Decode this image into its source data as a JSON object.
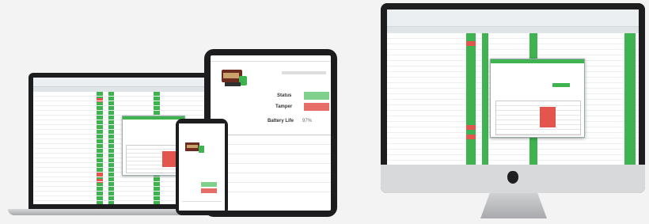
{
  "colors": {
    "accent_green": "#3fb34f",
    "alert_red": "#e3554d",
    "device_frame": "#1d1d1f",
    "background": "#f3f3f3"
  },
  "icons": {
    "apple_logo": "apple-logo-icon",
    "product_image": "machine-thumbnail"
  },
  "tablet": {
    "status_label": "Status",
    "tamper_label": "Tamper",
    "battery_label": "Battery Life",
    "battery_value": "97%"
  }
}
